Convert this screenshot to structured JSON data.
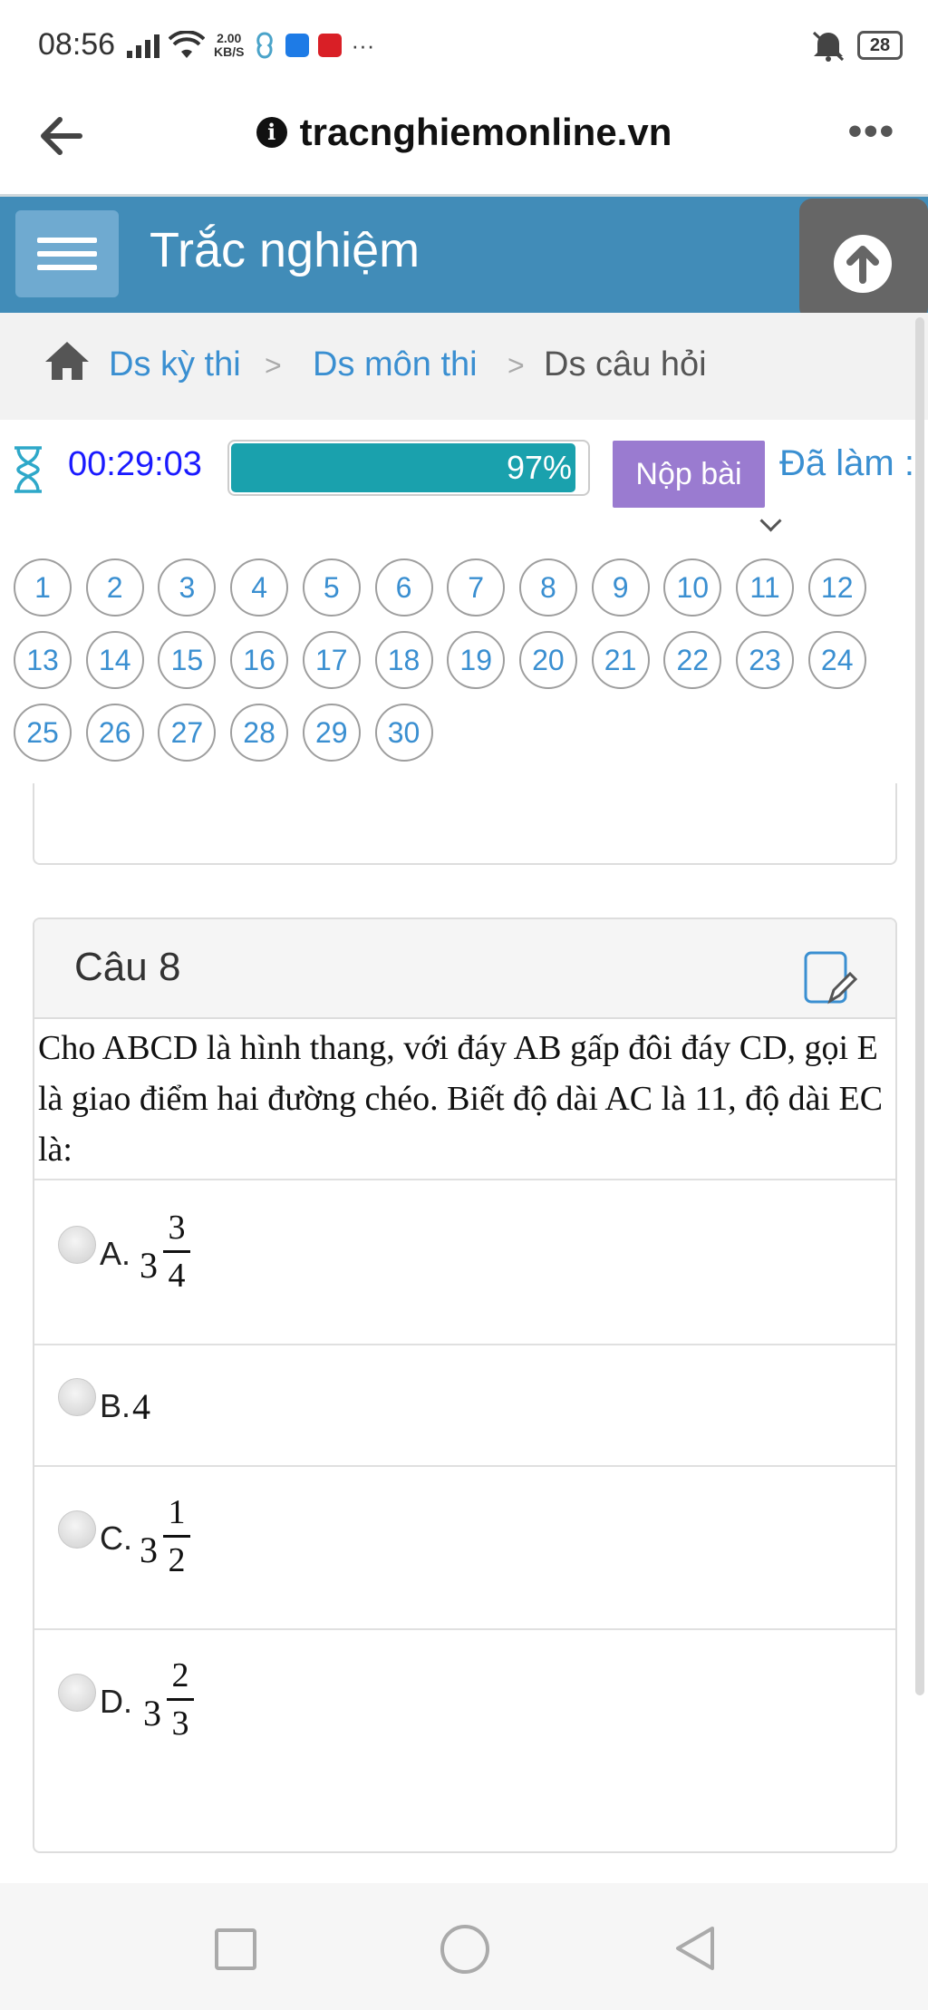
{
  "status_bar": {
    "time": "08:56",
    "net_speed_value": "2.00",
    "net_speed_unit": "KB/S",
    "more": "···",
    "battery": "28"
  },
  "url_bar": {
    "info": "i",
    "url": "tracnghiemonline.vn",
    "more": "•••"
  },
  "header": {
    "title": "Trắc nghiệm"
  },
  "breadcrumb": {
    "items": [
      "Ds kỳ thi",
      "Ds môn thi",
      "Ds câu hỏi"
    ],
    "separator": ">"
  },
  "toolbar": {
    "timer": "00:29:03",
    "progress_label": "97%",
    "progress_value": 0.97,
    "submit_label": "Nộp bài",
    "done_label": "Đã làm :"
  },
  "question_nav": {
    "numbers": [
      "1",
      "2",
      "3",
      "4",
      "5",
      "6",
      "7",
      "8",
      "9",
      "10",
      "11",
      "12",
      "13",
      "14",
      "15",
      "16",
      "17",
      "18",
      "19",
      "20",
      "21",
      "22",
      "23",
      "24",
      "25",
      "26",
      "27",
      "28",
      "29",
      "30"
    ]
  },
  "question": {
    "title": "Câu 8",
    "text": "Cho ABCD là hình thang, với đáy AB gấp đôi đáy CD, gọi E là giao điểm hai đường chéo. Biết độ dài AC là 11, độ dài EC là:",
    "options": [
      {
        "label": "A.",
        "whole": "3",
        "numerator": "3",
        "denominator": "4"
      },
      {
        "label": "B.",
        "text": "4"
      },
      {
        "label": "C.",
        "whole": "3",
        "numerator": "1",
        "denominator": "2"
      },
      {
        "label": "D.",
        "whole": "3",
        "numerator": "2",
        "denominator": "3"
      }
    ]
  },
  "colors": {
    "header_bg": "#418cb8",
    "link": "#3a8fd1",
    "timer": "#1a1aff",
    "progress": "#1aa1ad",
    "submit_bg": "#9a7bd0"
  },
  "icons": [
    "signal-icon",
    "wifi-icon",
    "app-icon",
    "zalo-icon",
    "news-icon",
    "mute-icon",
    "battery-icon",
    "back-arrow-icon",
    "info-icon",
    "menu-icon",
    "arrow-up-icon",
    "home-icon",
    "hourglass-icon",
    "note-edit-icon",
    "nav-recent-icon",
    "nav-home-icon",
    "nav-back-icon"
  ]
}
